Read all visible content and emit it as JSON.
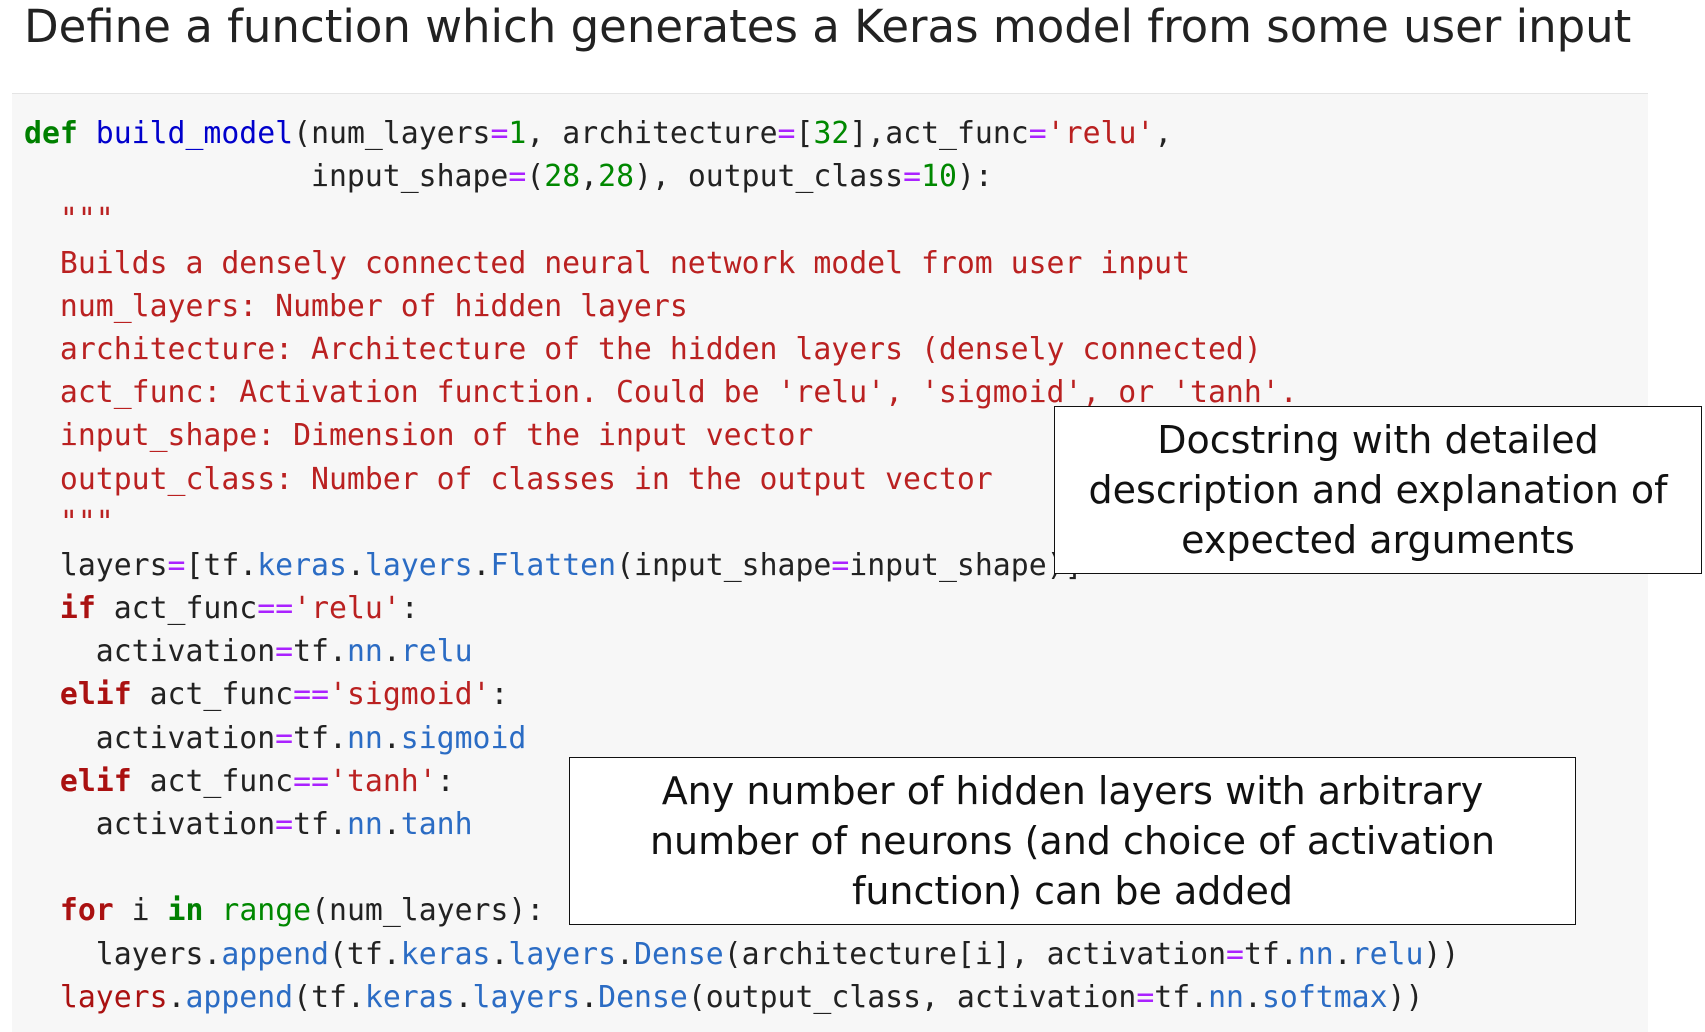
{
  "heading": "Define a function which generates a Keras model from some user input",
  "code": {
    "l1": {
      "kw": "def",
      "name": "build_model",
      "p1": "(num_layers",
      "eq1": "=",
      "n1": "1",
      "p2": ", architecture",
      "eq2": "=",
      "p3": "[",
      "n2": "32",
      "p4": "],act_func",
      "eq3": "=",
      "s1": "'relu'",
      "p5": ","
    },
    "l2": {
      "indent": "                input_shape",
      "eq1": "=",
      "p1": "(",
      "n1": "28",
      "p2": ",",
      "n2": "28",
      "p3": "), output_class",
      "eq2": "=",
      "n3": "10",
      "p4": "):"
    },
    "doc": [
      "  \"\"\"",
      "  Builds a densely connected neural network model from user input",
      "  num_layers: Number of hidden layers",
      "  architecture: Architecture of the hidden layers (densely connected)",
      "  act_func: Activation function. Could be 'relu', 'sigmoid', or 'tanh'.",
      "  input_shape: Dimension of the input vector",
      "  output_class: Number of classes in the output vector",
      "  \"\"\""
    ],
    "l11": {
      "a": "  layers",
      "eq": "=",
      "b": "[tf.",
      "c": "keras",
      "d": ".",
      "e": "layers",
      "f": ".",
      "g": "Flatten",
      "h": "(input_shape",
      "eq2": "=",
      "i": "input_shape)]"
    },
    "l12": {
      "kw": "if",
      "a": " act_func",
      "eq": "==",
      "s": "'relu'",
      "b": ":"
    },
    "l13": {
      "a": "    activation",
      "eq": "=",
      "b": "tf.",
      "c": "nn",
      "d": ".",
      "e": "relu"
    },
    "l14": {
      "kw": "elif",
      "a": " act_func",
      "eq": "==",
      "s": "'sigmoid'",
      "b": ":"
    },
    "l15": {
      "a": "    activation",
      "eq": "=",
      "b": "tf.",
      "c": "nn",
      "d": ".",
      "e": "sigmoid"
    },
    "l16": {
      "kw": "elif",
      "a": " act_func",
      "eq": "==",
      "s": "'tanh'",
      "b": ":"
    },
    "l17": {
      "a": "    activation",
      "eq": "=",
      "b": "tf.",
      "c": "nn",
      "d": ".",
      "e": "tanh"
    },
    "l19": {
      "kw": "for",
      "a": " i ",
      "kw2": "in",
      "b": " ",
      "fn": "range",
      "c": "(num_layers):"
    },
    "l20": {
      "a": "    layers.",
      "fn": "append",
      "b": "(tf.",
      "c": "keras",
      "d": ".",
      "e": "layers",
      "f": ".",
      "g": "Dense",
      "h": "(architecture[i], activation",
      "eq": "=",
      "i": "tf.",
      "j": "nn",
      "k": ".",
      "l": "relu",
      "m": "))"
    },
    "l21": {
      "var": "layers",
      "a": ".",
      "fn": "append",
      "b": "(tf.",
      "c": "keras",
      "d": ".",
      "e": "layers",
      "f": ".",
      "g": "Dense",
      "h": "(output_class, activation",
      "eq": "=",
      "i": "tf.",
      "j": "nn",
      "k": ".",
      "l": "softmax",
      "m": "))"
    }
  },
  "callouts": {
    "docstring": "Docstring with detailed\ndescription and explanation of\nexpected arguments",
    "layers": "Any number of hidden layers with arbitrary\nnumber of neurons (and choice of activation\nfunction) can be added"
  }
}
